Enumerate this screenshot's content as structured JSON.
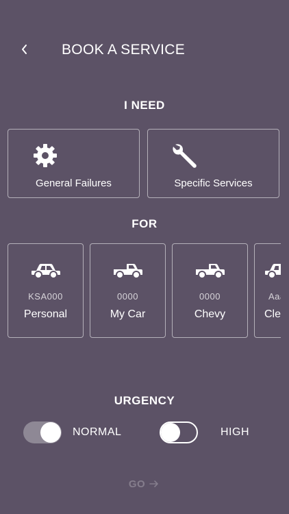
{
  "header": {
    "title": "BOOK A SERVICE",
    "back_icon": "chevron-left-icon"
  },
  "need_section": {
    "title": "I NEED",
    "options": [
      {
        "label": "General Failures",
        "icon": "gear-icon"
      },
      {
        "label": "Specific Services",
        "icon": "wrench-icon"
      }
    ]
  },
  "for_section": {
    "title": "FOR",
    "vehicles": [
      {
        "plate": "KSA000",
        "name": "Personal",
        "icon": "sedan-icon"
      },
      {
        "plate": "0000",
        "name": "My Car",
        "icon": "pickup-truck-icon"
      },
      {
        "plate": "0000",
        "name": "Chevy",
        "icon": "pickup-truck-icon"
      },
      {
        "plate": "Aaa",
        "name": "Cle",
        "icon": "car-icon"
      }
    ]
  },
  "urgency_section": {
    "title": "URGENCY",
    "normal": {
      "label": "NORMAL",
      "on": true
    },
    "high": {
      "label": "HIGH",
      "on": false
    }
  },
  "footer": {
    "go_label": "GO",
    "go_icon": "arrow-right-icon"
  },
  "colors": {
    "background": "#5c5266",
    "toggle_on_track": "#8e8895"
  }
}
